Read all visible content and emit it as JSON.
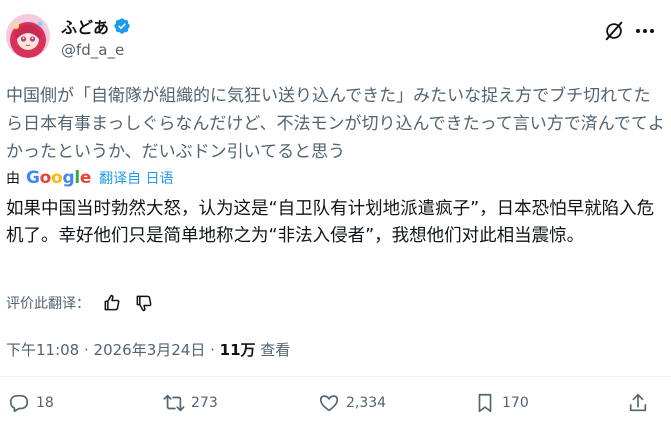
{
  "author": {
    "name": "ふどあ",
    "handle": "@fd_a_e"
  },
  "tweet": {
    "original_text": "中国側が「自衛隊が組織的に気狂い送り込んできた」みたいな捉え方でブチ切れてたら日本有事まっしぐらなんだけど、不法モンが切り込んできたって言い方で済んでてよかったというか、だいぶドン引いてると思う",
    "translation_by": "由",
    "google_logo": "Google",
    "translated_from": "翻译自 日语",
    "translated_text": "如果中国当时勃然大怒，认为这是“自卫队有计划地派遣疯子”，日本恐怕早就陷入危机了。幸好他们只是简单地称之为“非法入侵者”，我想他们对此相当震惊。",
    "rate_label": "评价此翻译：",
    "time_date": "下午11:08 · 2026年3月24日 · ",
    "views_count": "11万",
    "views_label": " 查看"
  },
  "actions": {
    "replies": "18",
    "reposts": "273",
    "likes": "2,334",
    "bookmarks": "170"
  },
  "colors": {
    "text_primary": "#0f1419",
    "text_secondary": "#536471",
    "verified": "#1d9bf0",
    "link": "#1d9bf0"
  }
}
